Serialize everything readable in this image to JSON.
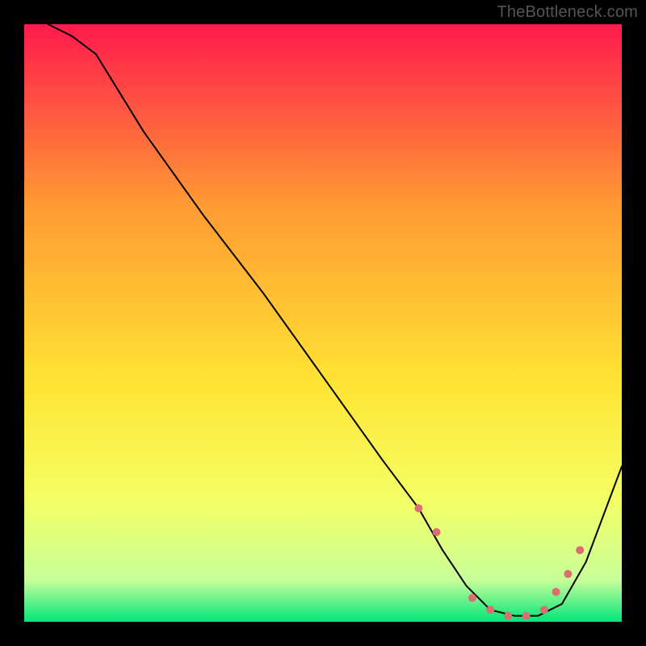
{
  "attribution": "TheBottleneck.com",
  "chart_data": {
    "type": "line",
    "title": "",
    "xlabel": "",
    "ylabel": "",
    "xlim": [
      0,
      100
    ],
    "ylim": [
      0,
      100
    ],
    "grid": false,
    "series": [
      {
        "name": "curve",
        "x": [
          4,
          8,
          12,
          20,
          30,
          40,
          50,
          60,
          66,
          70,
          74,
          78,
          82,
          86,
          90,
          94,
          100
        ],
        "values": [
          100,
          98,
          95,
          82,
          68,
          55,
          41,
          27,
          19,
          12,
          6,
          2,
          1,
          1,
          3,
          10,
          26
        ],
        "color": "#000000",
        "width": 2
      },
      {
        "name": "markers",
        "type": "scatter",
        "x": [
          66,
          69,
          75,
          78,
          81,
          84,
          87,
          89,
          91,
          93
        ],
        "values": [
          19,
          15,
          4,
          2,
          1,
          1,
          2,
          5,
          8,
          12
        ],
        "color": "#d96f6f",
        "size": 10
      }
    ],
    "background_gradient": {
      "top": "#ff1a4d",
      "mid_upper": "#ff9933",
      "mid": "#ffe433",
      "mid_lower": "#f4ff66",
      "near_bottom": "#c8ff99",
      "bottom": "#00e67a"
    }
  }
}
